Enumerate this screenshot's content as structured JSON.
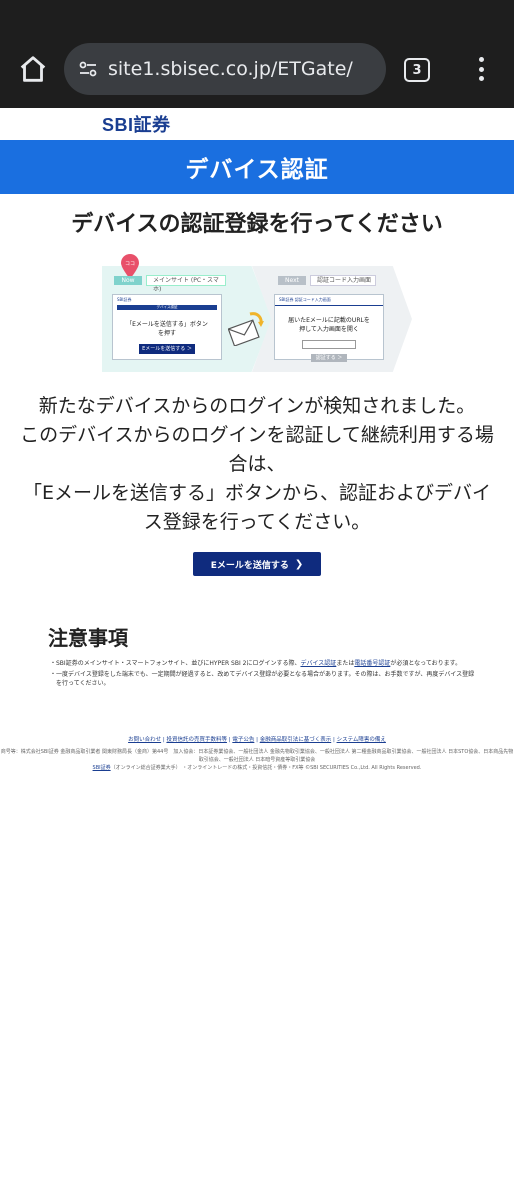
{
  "browser": {
    "url": "site1.sbisec.co.jp/ETGate/",
    "tab_count": "3"
  },
  "logo": "SBI証券",
  "header": {
    "title": "デバイス認証"
  },
  "main_title": "デバイスの認証登録を行ってください",
  "illustration": {
    "pin_label": "ココ",
    "now_tag": "Now",
    "now_label": "メインサイト (PC・スマホ)",
    "card1_header": "SBI証券",
    "card1_sub": "デバイス認証",
    "card1_text_1": "「Eメールを送信する」ボタン",
    "card1_text_2": "を押す",
    "card1_button": "Eメールを送信する ＞",
    "next_tag": "Next",
    "next_label": "認証コード入力画面",
    "card2_header": "SBI証券  認証コード入力画面",
    "card2_text_1": "届いたEメールに記載のURLを",
    "card2_text_2": "押して入力画面を開く",
    "card2_button": "認証する ＞"
  },
  "detection_message": {
    "line1": "新たなデバイスからのログインが検知されました。",
    "line2": "このデバイスからのログインを認証して継続利用する場",
    "line3": "合は、",
    "line4": "「Eメールを送信する」ボタンから、認証およびデバイ",
    "line5": "ス登録を行ってください。"
  },
  "send_button": "Eメールを送信する",
  "notes": {
    "title": "注意事項",
    "item1_a": "・SBI証券のメインサイト・スマートフォンサイト、並びにHYPER SBI 2にログインする際、",
    "item1_link1": "デバイス認証",
    "item1_b": "または",
    "item1_link2": "電話番号認証",
    "item1_c": "が必須となっております。",
    "item2": "・一度デバイス登録をした端末でも、一定期間が経過すると、改めてデバイス登録が必要となる場合があります。その際は、お手数ですが、再度デバイス登録を行ってください。"
  },
  "footer": {
    "links": [
      "お問い合わせ",
      "投資信託の売買手数料等",
      "電子公告",
      "金融商品取引法に基づく表示",
      "システム障害の備え"
    ],
    "legal_1": "商号等：株式会社SBI証券 金融商品取引業者 関東財務局長（金商）第44号　加入協会：日本証券業協会、一般社団法人 金融先物取引業協会、一般社団法人 第二種金融商品取引業協会、一般社団法人 日本STO協会、日本商品先物取引協会、一般社団法人 日本暗号資産等取引業協会",
    "legal_link": "SBI証券",
    "legal_2": "（オンライン総合証券業大手） ・オンライントレードの株式・投資信託・債券・FX等 ©SBI SECURITIES Co.,Ltd. All Rights Reserved."
  }
}
